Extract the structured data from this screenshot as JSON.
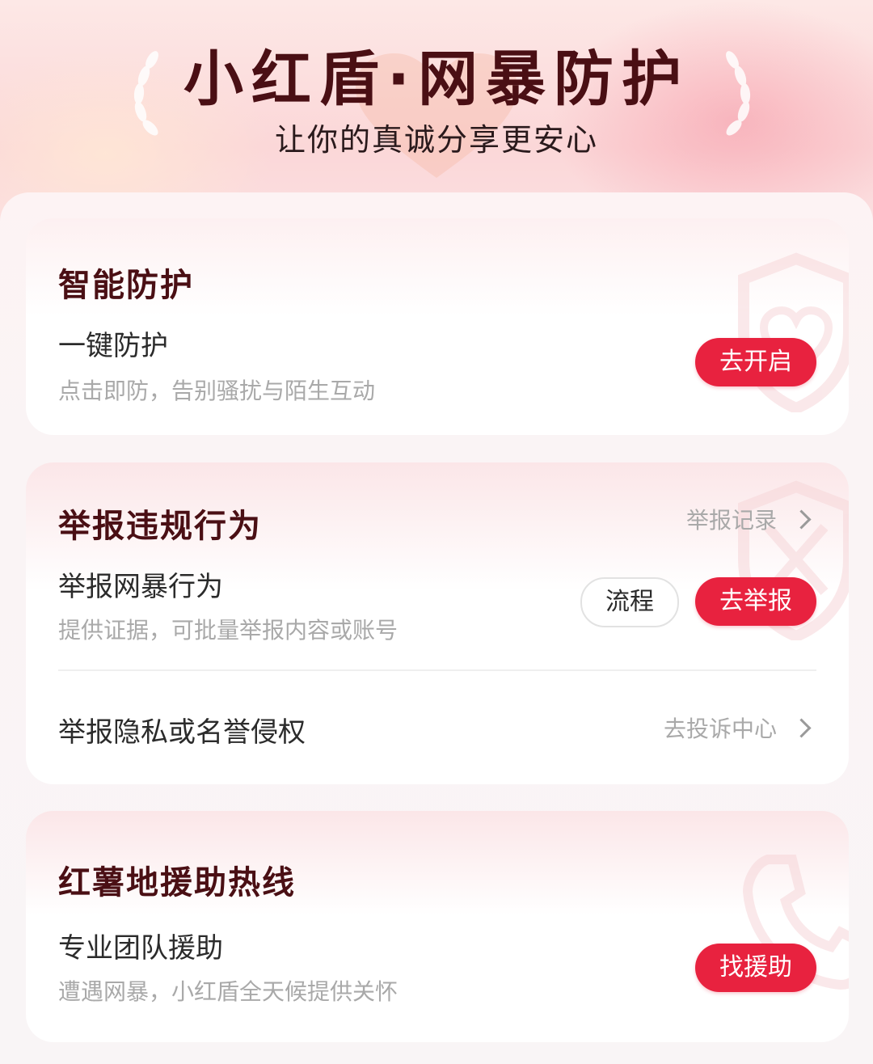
{
  "header": {
    "title": "小红盾·网暴防护",
    "subtitle": "让你的真诚分享更安心"
  },
  "sections": [
    {
      "title": "智能防护",
      "item": {
        "title": "一键防护",
        "desc": "点击即防，告别骚扰与陌生互动",
        "button": "去开启"
      }
    },
    {
      "title": "举报违规行为",
      "link": "举报记录",
      "item": {
        "title": "举报网暴行为",
        "desc": "提供证据，可批量举报内容或账号",
        "secondary_button": "流程",
        "button": "去举报"
      },
      "row": {
        "title": "举报隐私或名誉侵权",
        "link": "去投诉中心"
      }
    },
    {
      "title": "红薯地援助热线",
      "item": {
        "title": "专业团队援助",
        "desc": "遭遇网暴，小红盾全天候提供关怀",
        "button": "找援助"
      }
    }
  ],
  "colors": {
    "accent": "#e8223f",
    "title": "#4a0f14",
    "muted": "#a9a9a9"
  }
}
